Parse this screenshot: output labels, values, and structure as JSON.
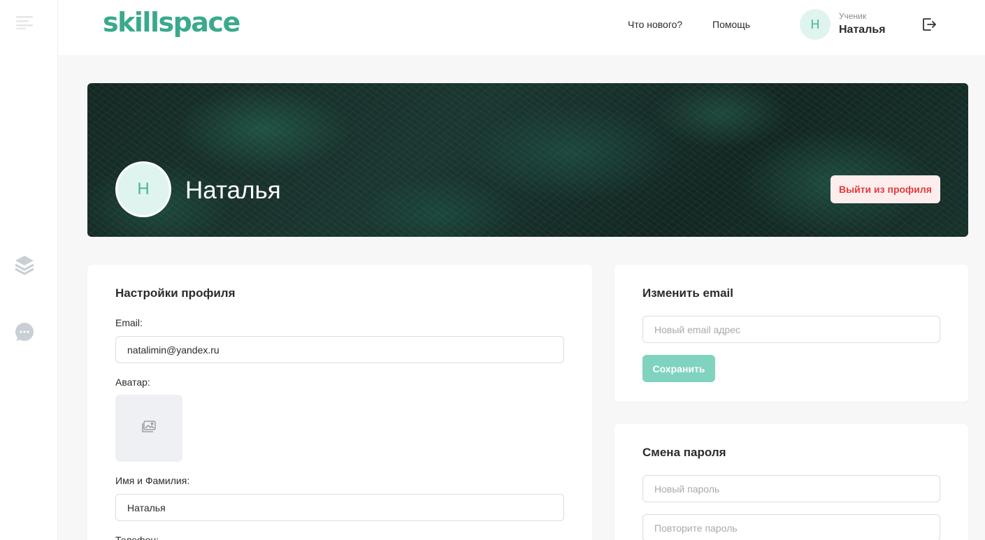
{
  "header": {
    "logo_text": "skillspace",
    "nav": {
      "whats_new": "Что нового?",
      "help": "Помощь"
    },
    "user": {
      "initial": "Н",
      "role": "Ученик",
      "name": "Наталья"
    }
  },
  "sidebar": {
    "icons": [
      "menu-icon",
      "layers-icon",
      "chat-icon"
    ]
  },
  "banner": {
    "initial": "Н",
    "name": "Наталья",
    "logout_label": "Выйти из профиля"
  },
  "profile_settings": {
    "title": "Настройки профиля",
    "email_label": "Email:",
    "email_value": "natalimin@yandex.ru",
    "avatar_label": "Аватар:",
    "name_label": "Имя и Фамилия:",
    "name_value": "Наталья",
    "phone_label": "Телефон:"
  },
  "change_email": {
    "title": "Изменить email",
    "new_email_placeholder": "Новый email адрес",
    "save_label": "Сохранить"
  },
  "change_password": {
    "title": "Смена пароля",
    "new_password_placeholder": "Новый пароль",
    "repeat_password_placeholder": "Повторите пароль"
  },
  "colors": {
    "accent": "#3aa98e",
    "accent_light": "#7fd3bf",
    "danger": "#e23b3b",
    "danger_bg": "#fdeded",
    "avatar_bg": "#dff4ee"
  }
}
